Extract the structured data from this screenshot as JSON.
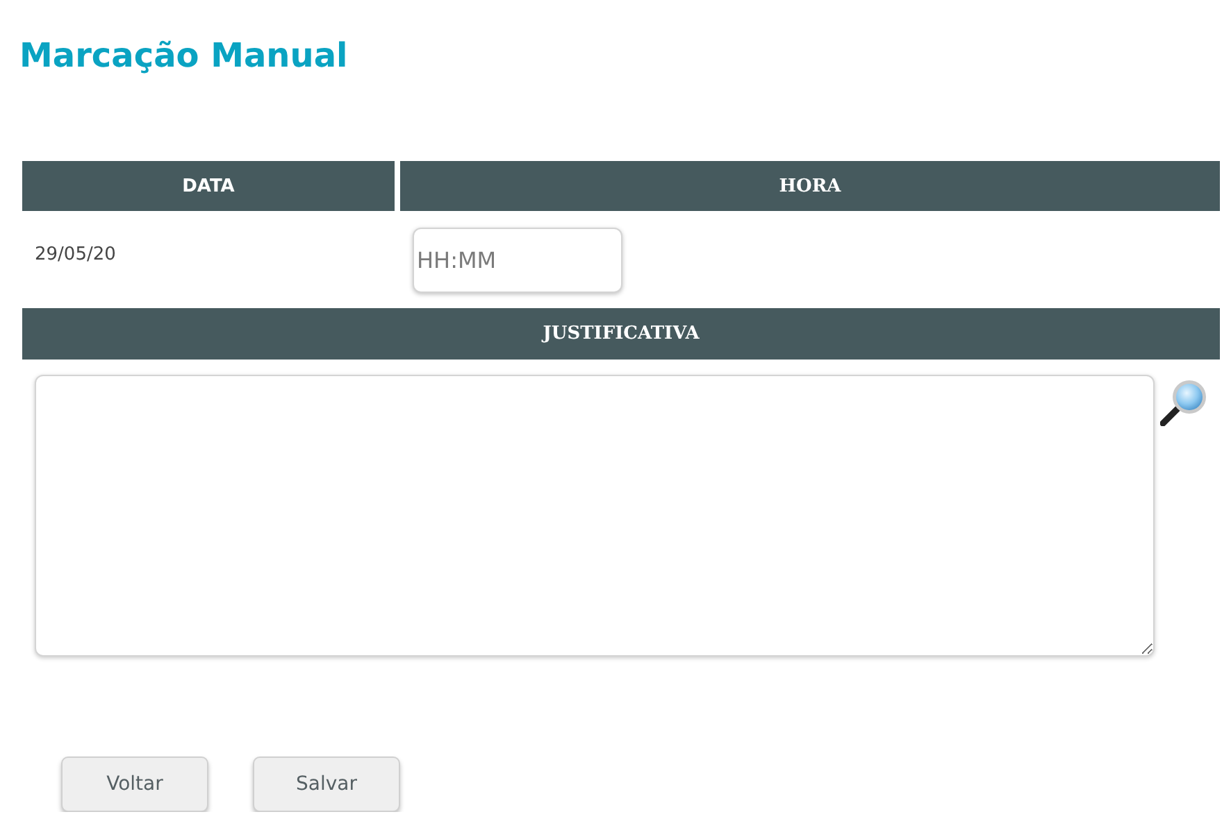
{
  "title": "Marcação Manual",
  "table": {
    "columns": [
      "DATA",
      "HORA"
    ],
    "row": {
      "date": "29/05/20",
      "time": {
        "placeholder": "HH:MM"
      }
    }
  },
  "justification": {
    "heading": "JUSTIFICATIVA"
  },
  "buttons": [
    "Voltar",
    "Salvar"
  ]
}
